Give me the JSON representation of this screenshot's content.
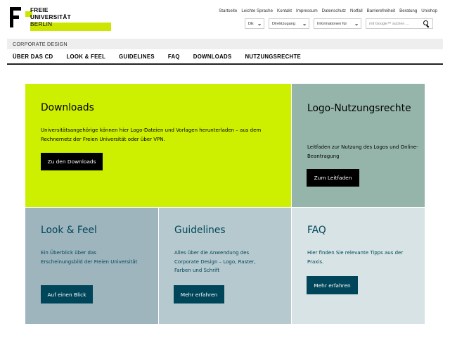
{
  "logo": {
    "line1": "FREIE",
    "line2": "UNIVERSITÄT",
    "line3": "BERLIN",
    "brand_color": "#cce600"
  },
  "service_nav": [
    "Startseite",
    "Leichte Sprache",
    "Kontakt",
    "Impressum",
    "Datenschutz",
    "Notfall",
    "Barrierefreiheit",
    "Beratung",
    "Unishop"
  ],
  "tools": {
    "language": "DE",
    "direct_access": "Direktzugang",
    "info_for": "Informationen für",
    "search_placeholder": "mit Google™ suchen ..."
  },
  "section_title": "CORPORATE DESIGN",
  "main_nav": [
    "ÜBER DAS CD",
    "LOOK & FEEL",
    "GUIDELINES",
    "FAQ",
    "DOWNLOADS",
    "NUTZUNGSRECHTE"
  ],
  "tiles": {
    "downloads": {
      "title": "Downloads",
      "text": "Universitätsangehörige können hier Logo-Dateien und Vorlagen herunterladen – aus dem Rechnernetz der Freien Universität oder über VPN.",
      "button": "Zu den Downloads",
      "color": "#cdf000"
    },
    "logo_rights": {
      "title": "Logo-Nutzungsrechte",
      "text": "Leitfaden zur Nutzung des Logos und Online-Beantragung",
      "button": "Zum Leitfaden",
      "color": "#95b5aa"
    },
    "look_feel": {
      "title": "Look & Feel",
      "text": "Ein Überblick über das Erscheinungsbild der Freien Universität",
      "button": "Auf einen Blick",
      "color": "#9fb5bd"
    },
    "guidelines": {
      "title": "Guidelines",
      "text": "Alles über die Anwendung des Corporate Design – Logo, Raster, Farben und Schrift",
      "button": "Mehr erfahren",
      "color": "#b6c9ce"
    },
    "faq": {
      "title": "FAQ",
      "text": "Hier finden Sie relevante Tipps aus der Praxis.",
      "button": "Mehr erfahren",
      "color": "#d7e3e4"
    }
  }
}
